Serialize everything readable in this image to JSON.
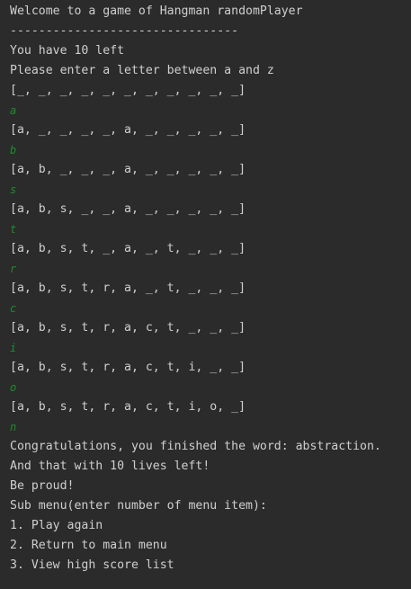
{
  "console": {
    "lines": [
      {
        "text": "Welcome to a game of Hangman randomPlayer",
        "kind": "output"
      },
      {
        "text": "--------------------------------",
        "kind": "output"
      },
      {
        "text": "You have 10 left",
        "kind": "output"
      },
      {
        "text": "Please enter a letter between a and z",
        "kind": "output"
      },
      {
        "text": "[_, _, _, _, _, _, _, _, _, _, _]",
        "kind": "output"
      },
      {
        "text": "a",
        "kind": "input"
      },
      {
        "text": "[a, _, _, _, _, a, _, _, _, _, _]",
        "kind": "output"
      },
      {
        "text": "b",
        "kind": "input"
      },
      {
        "text": "[a, b, _, _, _, a, _, _, _, _, _]",
        "kind": "output"
      },
      {
        "text": "s",
        "kind": "input"
      },
      {
        "text": "[a, b, s, _, _, a, _, _, _, _, _]",
        "kind": "output"
      },
      {
        "text": "t",
        "kind": "input"
      },
      {
        "text": "[a, b, s, t, _, a, _, t, _, _, _]",
        "kind": "output"
      },
      {
        "text": "r",
        "kind": "input"
      },
      {
        "text": "[a, b, s, t, r, a, _, t, _, _, _]",
        "kind": "output"
      },
      {
        "text": "c",
        "kind": "input"
      },
      {
        "text": "[a, b, s, t, r, a, c, t, _, _, _]",
        "kind": "output"
      },
      {
        "text": "i",
        "kind": "input"
      },
      {
        "text": "[a, b, s, t, r, a, c, t, i, _, _]",
        "kind": "output"
      },
      {
        "text": "o",
        "kind": "input"
      },
      {
        "text": "[a, b, s, t, r, a, c, t, i, o, _]",
        "kind": "output"
      },
      {
        "text": "n",
        "kind": "input"
      },
      {
        "text": "Congratulations, you finished the word: abstraction.",
        "kind": "output"
      },
      {
        "text": "And that with 10 lives left!",
        "kind": "output"
      },
      {
        "text": "Be proud!",
        "kind": "output"
      },
      {
        "text": "Sub menu(enter number of menu item):",
        "kind": "output"
      },
      {
        "text": "1. Play again",
        "kind": "output"
      },
      {
        "text": "2. Return to main menu",
        "kind": "output"
      },
      {
        "text": "3. View high score list",
        "kind": "output"
      }
    ]
  },
  "colors": {
    "background": "#2b2b2b",
    "output_text": "#cfcfcf",
    "user_input_text": "#1b8f2a"
  }
}
